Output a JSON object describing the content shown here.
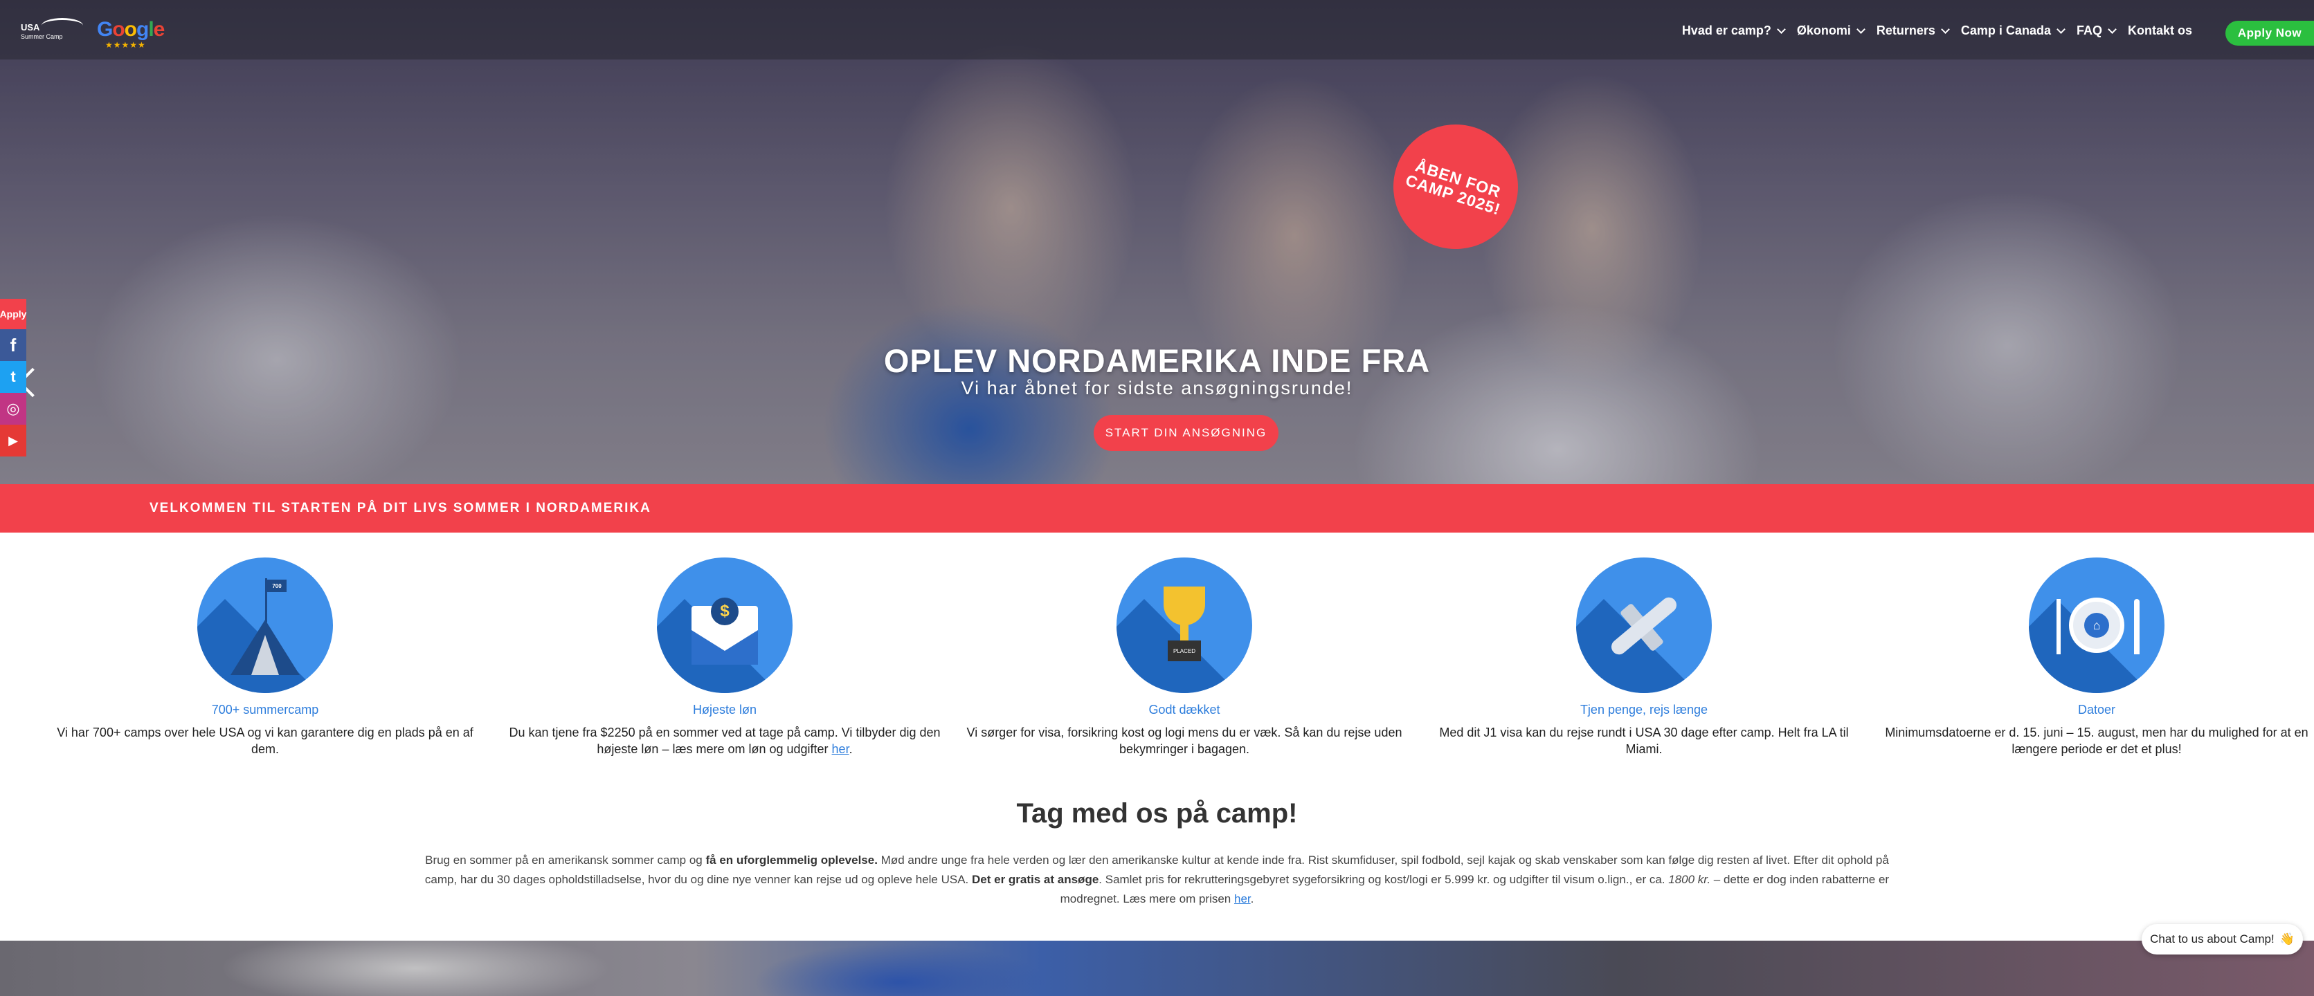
{
  "brand": {
    "usa_logo_title": "USA",
    "usa_logo_sub": "Summer Camp",
    "google_word": "Google",
    "google_stars": "★★★★★"
  },
  "nav": {
    "items": [
      {
        "label": "Hvad er camp?",
        "has_dropdown": true
      },
      {
        "label": "Økonomi",
        "has_dropdown": true
      },
      {
        "label": "Returners",
        "has_dropdown": true
      },
      {
        "label": "Camp i Canada",
        "has_dropdown": true
      },
      {
        "label": "FAQ",
        "has_dropdown": true
      },
      {
        "label": "Kontakt os",
        "has_dropdown": false
      }
    ],
    "apply_now": "Apply Now"
  },
  "hero": {
    "badge_line1": "ÅBEN FOR",
    "badge_line2": "CAMP 2025!",
    "title": "OPLEV NORDAMERIKA INDE FRA",
    "subtitle": "Vi har åbnet for sidste ansøgningsrunde!",
    "cta": "START DIN ANSØGNING"
  },
  "social": {
    "apply": "Apply",
    "facebook": "f",
    "twitter": "t",
    "instagram": "◎",
    "youtube": "▶"
  },
  "banner": {
    "text": "VELKOMMEN TIL STARTEN PÅ DIT LIVS SOMMER I NORDAMERIKA"
  },
  "features": [
    {
      "title": "700+ summercamp",
      "desc": "Vi har 700+ camps over hele USA og vi kan garantere dig en plads på en af dem.",
      "icon": "tent-icon",
      "flag_text": "700"
    },
    {
      "title": "Højeste løn",
      "desc": "Du kan tjene fra $2250 på en sommer ved at tage på camp. Vi tilbyder dig den højeste løn – læs mere om løn og udgifter ",
      "link": "her",
      "icon": "envelope-money-icon",
      "coin": "$"
    },
    {
      "title": "Godt dækket",
      "desc": "Vi sørger for visa, forsikring kost og logi mens du er væk. Så kan du rejse uden bekymringer i bagagen.",
      "icon": "trophy-icon",
      "plaque": "PLACED"
    },
    {
      "title": "Tjen penge, rejs længe",
      "desc": "Med dit J1 visa kan du rejse rundt i USA 30 dage efter camp. Helt fra LA til Miami.",
      "icon": "airplane-icon"
    },
    {
      "title": "Datoer",
      "desc": "Minimumsdatoerne er d. 15. juni – 15. august, men har du mulighed for at en længere periode er det et plus!",
      "icon": "plate-icon",
      "house": "⌂"
    }
  ],
  "section": {
    "title": "Tag med os på camp!",
    "p1_a": "Brug en sommer på en amerikansk sommer camp og ",
    "p1_b": "få en uforglemmelig oplevelse.",
    "p1_c": " Mød andre unge fra hele verden og lær den amerikanske kultur at kende inde fra. Rist skumfiduser, spil fodbold, sejl kajak og skab venskaber som kan følge dig resten af livet. Efter dit ophold på camp, har du 30 dages opholdstilladselse, hvor du og dine nye venner kan rejse ud og opleve hele USA. ",
    "p1_d": "Det er gratis at ansøge",
    "p1_e": ". Samlet pris for rekrutteringsgebyret sygeforsikring og kost/logi er 5.999 kr. og udgifter til visum o.lign., er ca. ",
    "p1_f": "1800 kr.",
    "p1_g": " – dette er dog inden rabatterne er modregnet. Læs mere om prisen ",
    "p1_link": "her",
    "p1_end": "."
  },
  "chat": {
    "label": "Chat to us about Camp!",
    "emoji": "👋"
  },
  "colors": {
    "accent_red": "#f2414b",
    "nav_green": "#2bbf3f",
    "icon_blue": "#3f90ea",
    "link_blue": "#2d7ddc"
  }
}
